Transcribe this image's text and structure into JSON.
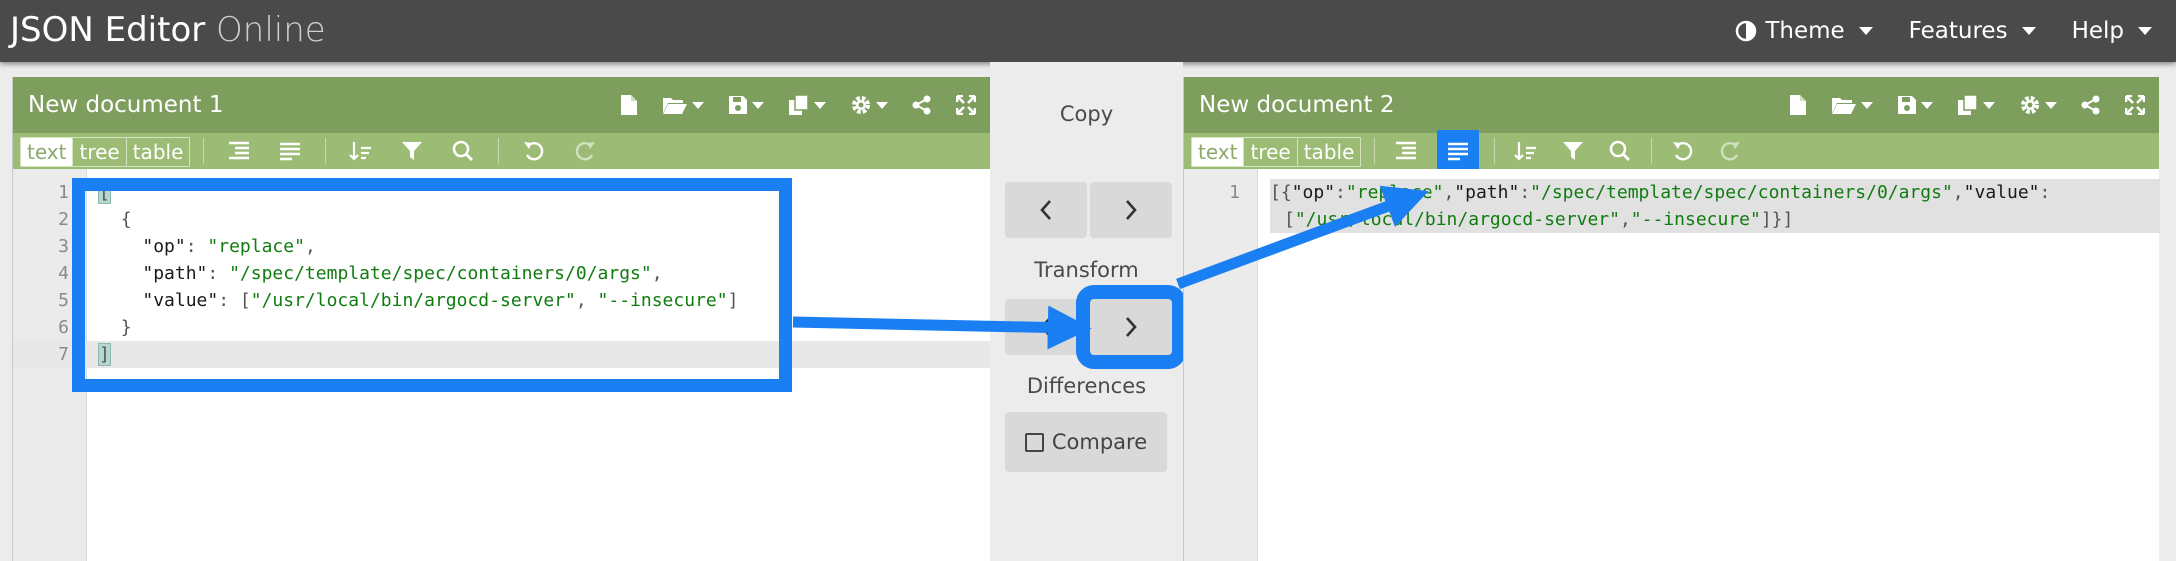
{
  "app": {
    "title_bold": "JSON Editor",
    "title_light": "Online"
  },
  "topmenu": [
    {
      "label": "Theme",
      "icon": "contrast-icon"
    },
    {
      "label": "Features"
    },
    {
      "label": "Help"
    }
  ],
  "left": {
    "title": "New document 1",
    "modes": [
      "text",
      "tree",
      "table"
    ],
    "active_mode": "text",
    "lines": [
      {
        "num": "1"
      },
      {
        "num": "2"
      },
      {
        "num": "3"
      },
      {
        "num": "4"
      },
      {
        "num": "5"
      },
      {
        "num": "6"
      },
      {
        "num": "7"
      }
    ],
    "code": {
      "open_bracket": "[",
      "open_brace": "{",
      "k1": "\"op\"",
      "v1": "\"replace\"",
      "k2": "\"path\"",
      "v2": "\"/spec/template/spec/containers/0/args\"",
      "k3": "\"value\"",
      "v3a": "\"/usr/local/bin/argocd-server\"",
      "v3b": "\"--insecure\"",
      "close_brace": "}",
      "close_bracket": "]"
    }
  },
  "right": {
    "title": "New document 2",
    "modes": [
      "text",
      "tree",
      "table"
    ],
    "active_mode": "text",
    "line_num": "1",
    "code": {
      "open": "[{",
      "k1": "\"op\"",
      "v1": "\"replace\"",
      "k2": "\"path\"",
      "v2": "\"/spec/template/spec/containers/0/args\"",
      "k3": "\"value\"",
      "v3a": "\"/usr/local/bin/argocd-server\"",
      "v3b": "\"--insecure\"",
      "close": "]}]"
    }
  },
  "middle": {
    "copy_label": "Copy",
    "transform_label": "Transform",
    "differences_label": "Differences",
    "compare_label": "Compare"
  },
  "colors": {
    "header_bg": "#4a4a4a",
    "panel_head": "#7e9e5e",
    "panel_tool": "#9cbc75",
    "highlight": "#1a7ff2",
    "string": "#107c10"
  }
}
